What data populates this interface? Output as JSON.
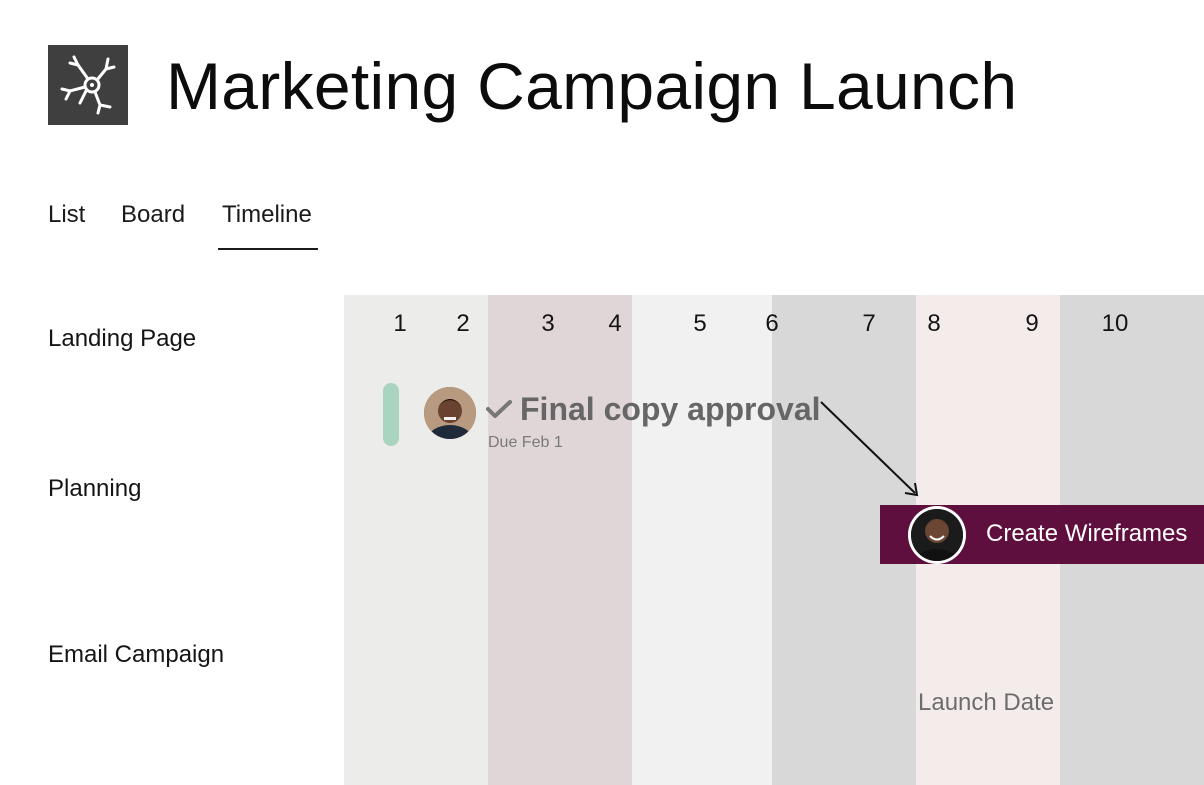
{
  "project": {
    "title": "Marketing Campaign Launch",
    "logo_icon": "network-icon"
  },
  "tabs": [
    {
      "label": "List",
      "active": false
    },
    {
      "label": "Board",
      "active": false
    },
    {
      "label": "Timeline",
      "active": true
    }
  ],
  "rows": [
    {
      "label": "Landing Page"
    },
    {
      "label": "Planning"
    },
    {
      "label": "Email Campaign"
    }
  ],
  "timeline": {
    "days": [
      "1",
      "2",
      "3",
      "4",
      "5",
      "6",
      "7",
      "8",
      "9",
      "10"
    ],
    "launch_label": "Launch Date"
  },
  "tasks": [
    {
      "title": "Final copy approval",
      "due": "Due Feb 1",
      "completed": true,
      "status_color": "#a9d4c0",
      "icon": "checkmark-icon"
    },
    {
      "title": "Create Wireframes",
      "bar_color": "#5f0f3d"
    }
  ],
  "colors": {
    "band_a": "#ececeb",
    "band_b": "#e0d6d7",
    "band_c": "#f2f1f1",
    "band_d": "#d8d8d8",
    "band_launch": "#f4ebeb",
    "muted_text": "#666666"
  }
}
